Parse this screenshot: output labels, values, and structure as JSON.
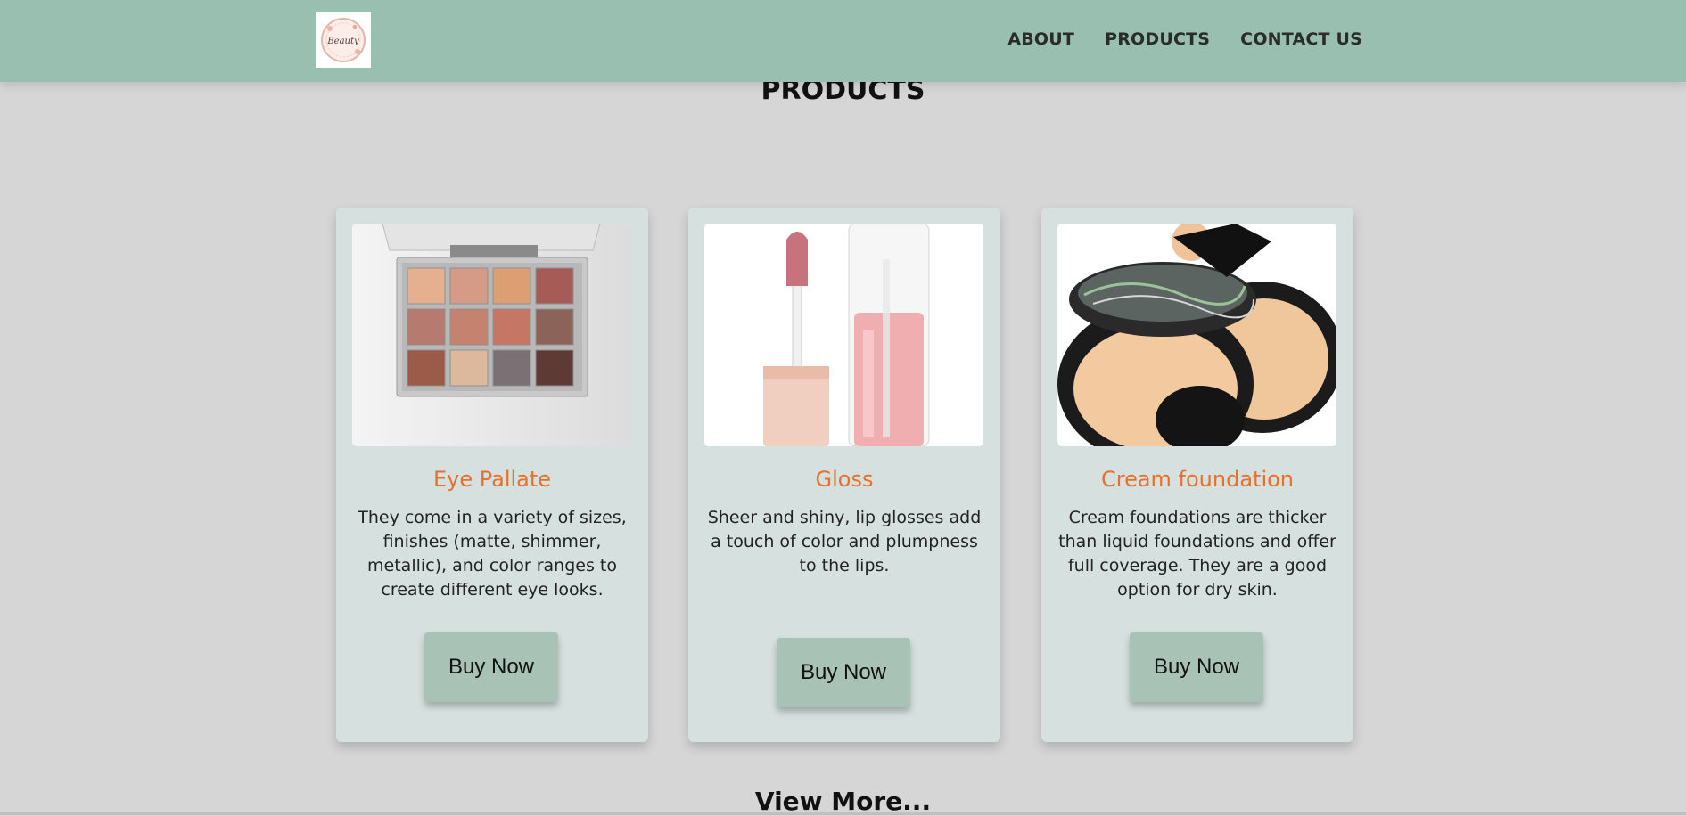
{
  "header": {
    "logo_text": "Beauty",
    "nav": [
      {
        "label": "ABOUT"
      },
      {
        "label": "PRODUCTS"
      },
      {
        "label": "CONTACT US"
      }
    ]
  },
  "main": {
    "title": "PRODUCTS",
    "products": [
      {
        "name": "Eye Pallate",
        "description": "They come in a variety of sizes, finishes (matte, shimmer, metallic), and color ranges to create different eye looks.",
        "button": "Buy Now"
      },
      {
        "name": "Gloss",
        "description": "Sheer and shiny, lip glosses add a touch of color and plumpness to the lips.",
        "button": "Buy Now"
      },
      {
        "name": "Cream foundation",
        "description": "Cream foundations are thicker than liquid foundations and offer full coverage. They are a good option for dry skin.",
        "button": "Buy Now"
      }
    ],
    "view_more": "View More..."
  },
  "colors": {
    "navbar": "#99bfb1",
    "background": "#d6d6d6",
    "card": "#d6e1df",
    "accent": "#e8702a",
    "button": "#a8c3b5"
  }
}
